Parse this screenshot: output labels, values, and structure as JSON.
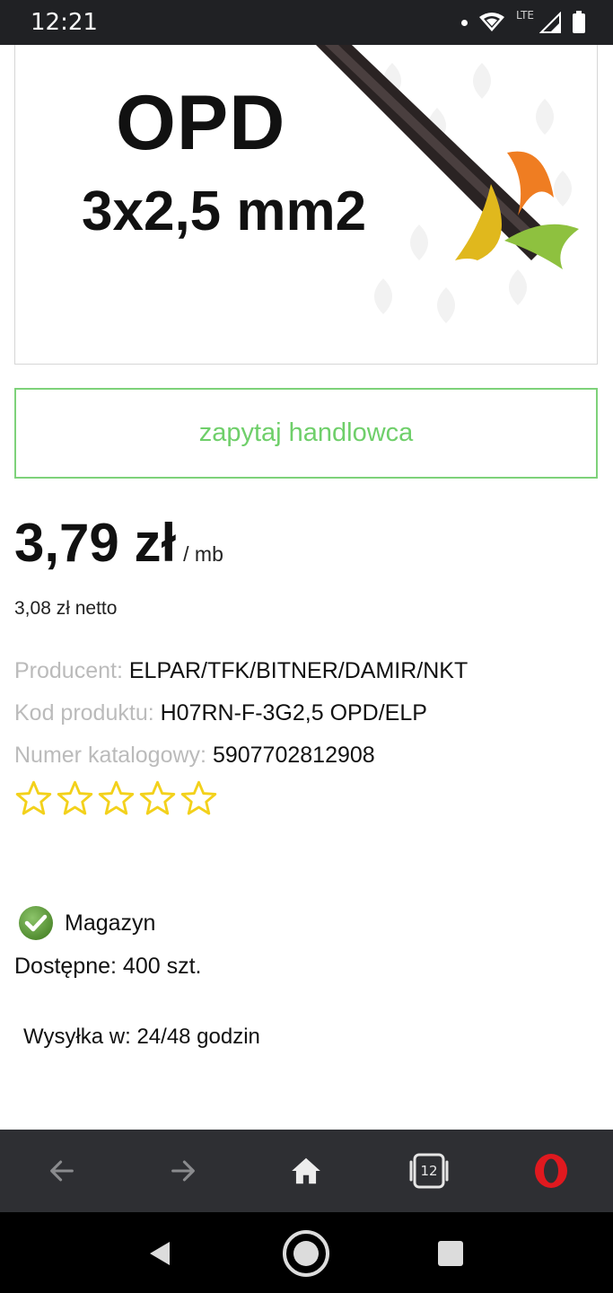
{
  "status_bar": {
    "time": "12:21",
    "network": "LTE"
  },
  "product_image": {
    "title": "OPD",
    "subtitle": "3x2,5 mm2"
  },
  "ask_button": {
    "label": "zapytaj handlowca"
  },
  "price": {
    "amount": "3,79 zł",
    "unit": "/ mb",
    "net": "3,08 zł netto"
  },
  "details": [
    {
      "label": "Producent:",
      "value": "ELPAR/TFK/BITNER/DAMIR/NKT"
    },
    {
      "label": "Kod produktu:",
      "value": "H07RN-F-3G2,5 OPD/ELP"
    },
    {
      "label": "Numer katalogowy:",
      "value": "5907702812908"
    }
  ],
  "rating": {
    "stars_filled": 0,
    "stars_total": 5
  },
  "stock": {
    "warehouse": "Magazyn",
    "available": "Dostępne: 400 szt.",
    "shipping": "Wysyłka w: 24/48 godzin"
  },
  "browser_bar": {
    "tab_count": "12"
  },
  "colors": {
    "accent_green": "#7ed27a",
    "star_yellow": "#f3d11b",
    "opera_red": "#e0191f",
    "check_green": "#5c9a3a"
  },
  "icons": [
    "wifi-icon",
    "signal-icon",
    "battery-icon",
    "back-arrow-icon",
    "forward-arrow-icon",
    "home-icon",
    "tabs-icon",
    "opera-menu-icon",
    "nav-back-icon",
    "nav-home-icon",
    "nav-recents-icon",
    "check-icon",
    "star-icon"
  ]
}
